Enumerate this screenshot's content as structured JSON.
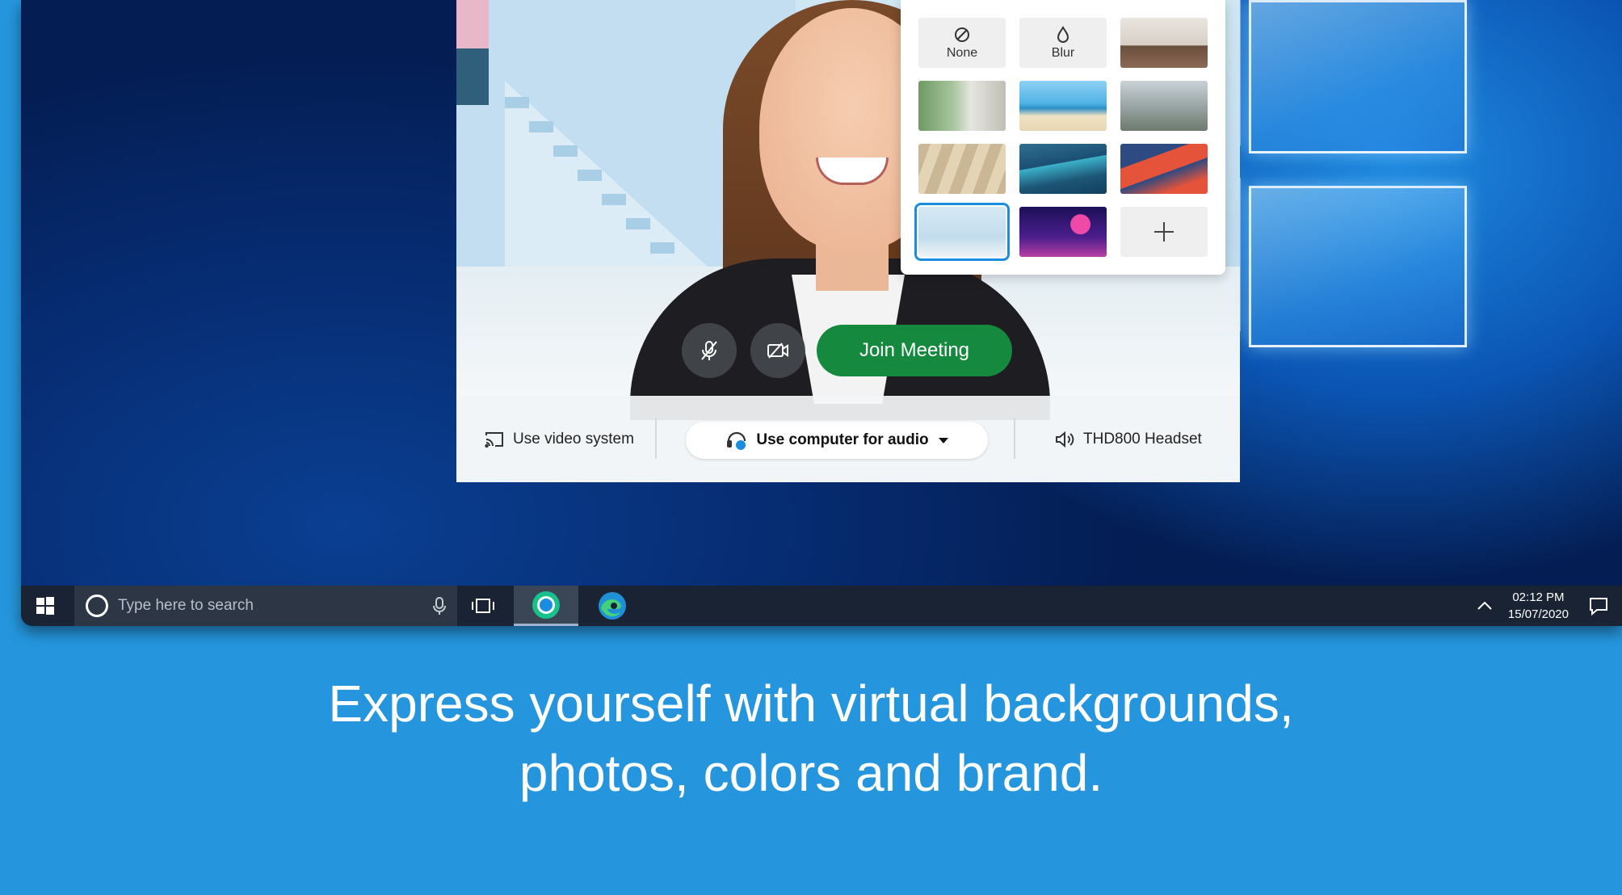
{
  "meeting": {
    "join_label": "Join Meeting",
    "mute_icon": "mic-off-icon",
    "video_icon": "video-off-icon"
  },
  "bottom_bar": {
    "video_system": "Use video system",
    "audio": "Use computer for audio",
    "headset": "THD800 Headset"
  },
  "background_picker": {
    "none_label": "None",
    "blur_label": "Blur",
    "selected_index": 9,
    "add_icon": "plus-icon"
  },
  "taskbar": {
    "search_placeholder": "Type here to search",
    "time": "02:12 PM",
    "date": "15/07/2020"
  },
  "caption": {
    "line1": "Express yourself with virtual backgrounds,",
    "line2": "photos, colors and brand."
  },
  "colors": {
    "page_bg": "#2596dd",
    "join_green": "#15893e",
    "taskbar": "#1a2333",
    "accent_blue": "#1a8de0"
  }
}
